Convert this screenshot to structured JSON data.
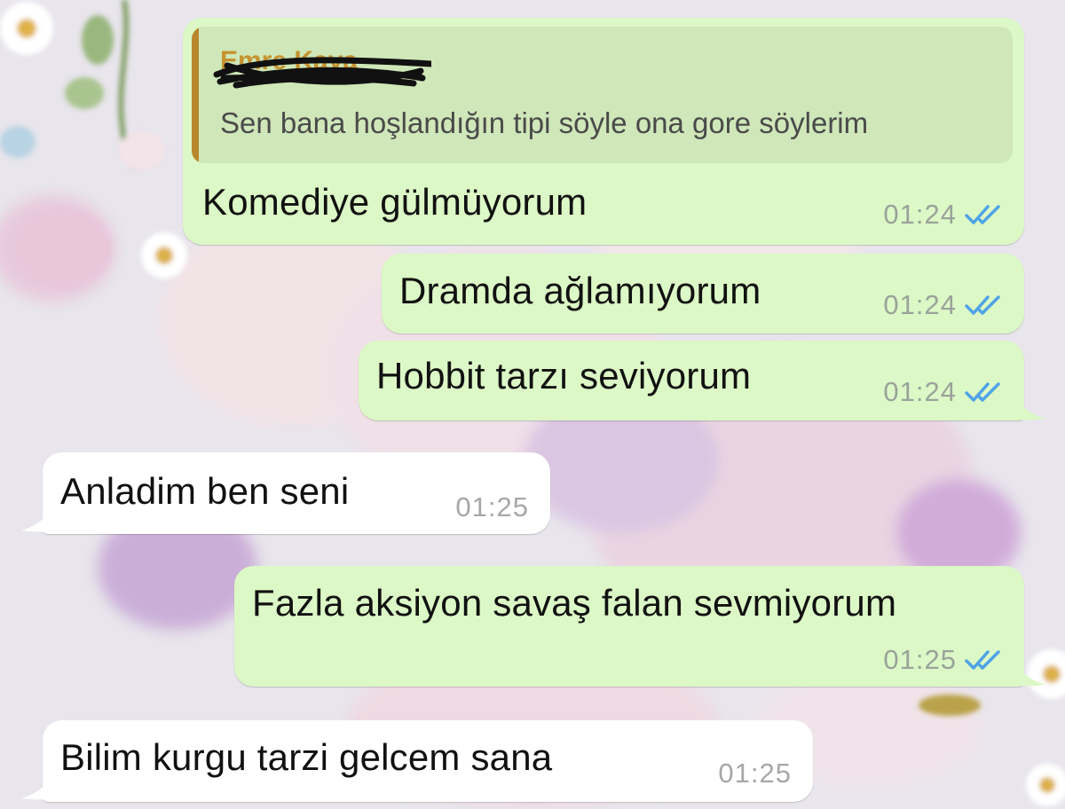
{
  "colors": {
    "outgoing_bubble": "#dcf8c6",
    "incoming_bubble": "#ffffff",
    "quote_background": "#cfe7b9",
    "quote_accent": "#b8862c",
    "read_ticks": "#4fa3e6"
  },
  "icons": {
    "read_receipt": "double-check-icon"
  },
  "messages": [
    {
      "direction": "outgoing",
      "quoted": {
        "sender": "Emre Kaya",
        "sender_redacted": true,
        "text": "Sen bana hoşlandığın tipi söyle ona gore söylerim"
      },
      "text": "Komediye gülmüyorum",
      "time": "01:24",
      "status": "read"
    },
    {
      "direction": "outgoing",
      "text": "Dramda ağlamıyorum",
      "time": "01:24",
      "status": "read"
    },
    {
      "direction": "outgoing",
      "text": "Hobbit tarzı seviyorum",
      "time": "01:24",
      "status": "read"
    },
    {
      "direction": "incoming",
      "text": "Anladim ben seni",
      "time": "01:25"
    },
    {
      "direction": "outgoing",
      "text": "Fazla aksiyon savaş falan sevmiyorum",
      "time": "01:25",
      "status": "read"
    },
    {
      "direction": "incoming",
      "text": "Bilim kurgu tarzi gelcem sana",
      "time": "01:25"
    }
  ]
}
